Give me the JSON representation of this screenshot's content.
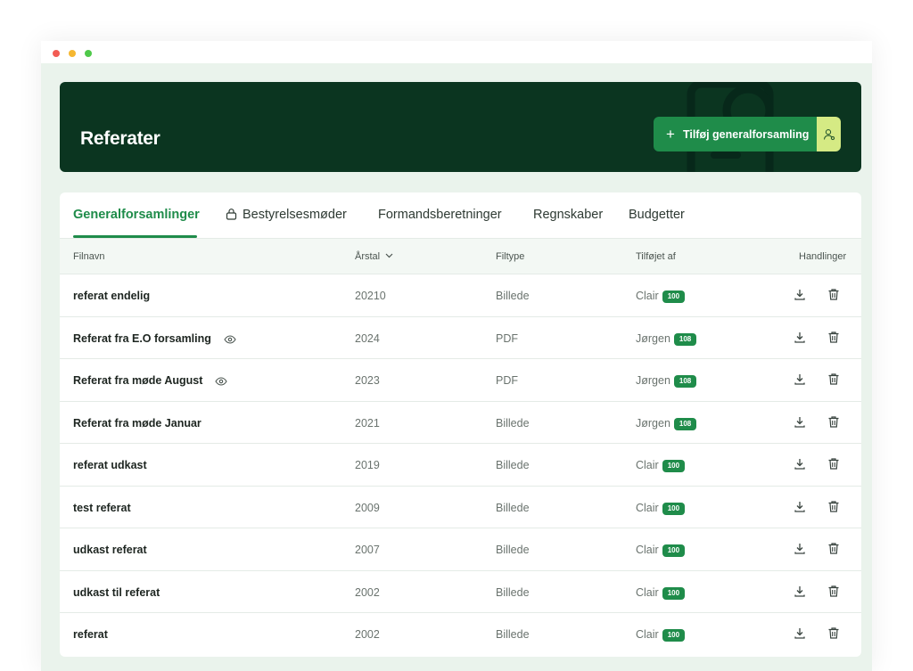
{
  "header": {
    "title": "Referater",
    "add_button_label": "Tilføj generalforsamling",
    "add_button_icon": "plus-icon",
    "secondary_button_icon": "person-icon"
  },
  "tabs": [
    {
      "label": "Generalforsamlinger",
      "active": true,
      "icon": ""
    },
    {
      "label": "Bestyrelsesmøder",
      "active": false,
      "icon": "lock-icon"
    },
    {
      "label": "Formandsberetninger",
      "active": false,
      "icon": ""
    },
    {
      "label": "Regnskaber",
      "active": false,
      "icon": ""
    },
    {
      "label": "Budgetter",
      "active": false,
      "icon": ""
    }
  ],
  "table": {
    "columns": {
      "name": "Filnavn",
      "year": "Årstal",
      "year_sort_icon": "chevron-down-icon",
      "type": "Filtype",
      "added_by": "Tilføjet af",
      "actions": "Handlinger"
    },
    "rows": [
      {
        "name": "referat endelig",
        "preview": false,
        "year": "20210",
        "type": "Billede",
        "user": "Clair",
        "badge": "100"
      },
      {
        "name": "Referat fra E.O forsamling",
        "preview": true,
        "year": "2024",
        "type": "PDF",
        "user": "Jørgen",
        "badge": "108"
      },
      {
        "name": "Referat fra møde August",
        "preview": true,
        "year": "2023",
        "type": "PDF",
        "user": "Jørgen",
        "badge": "108"
      },
      {
        "name": "Referat fra møde Januar",
        "preview": false,
        "year": "2021",
        "type": "Billede",
        "user": "Jørgen",
        "badge": "108"
      },
      {
        "name": "referat udkast",
        "preview": false,
        "year": "2019",
        "type": "Billede",
        "user": "Clair",
        "badge": "100"
      },
      {
        "name": "test referat",
        "preview": false,
        "year": "2009",
        "type": "Billede",
        "user": "Clair",
        "badge": "100"
      },
      {
        "name": "udkast referat",
        "preview": false,
        "year": "2007",
        "type": "Billede",
        "user": "Clair",
        "badge": "100"
      },
      {
        "name": "udkast til referat",
        "preview": false,
        "year": "2002",
        "type": "Billede",
        "user": "Clair",
        "badge": "100"
      },
      {
        "name": "referat",
        "preview": false,
        "year": "2002",
        "type": "Billede",
        "user": "Clair",
        "badge": "100"
      }
    ],
    "row_actions": [
      "download-icon",
      "trash-icon"
    ]
  },
  "colors": {
    "hero_bg": "#0b3520",
    "accent_green": "#1f8c4a",
    "lime": "#d5ea84",
    "canvas_bg": "#eaf3ec"
  }
}
